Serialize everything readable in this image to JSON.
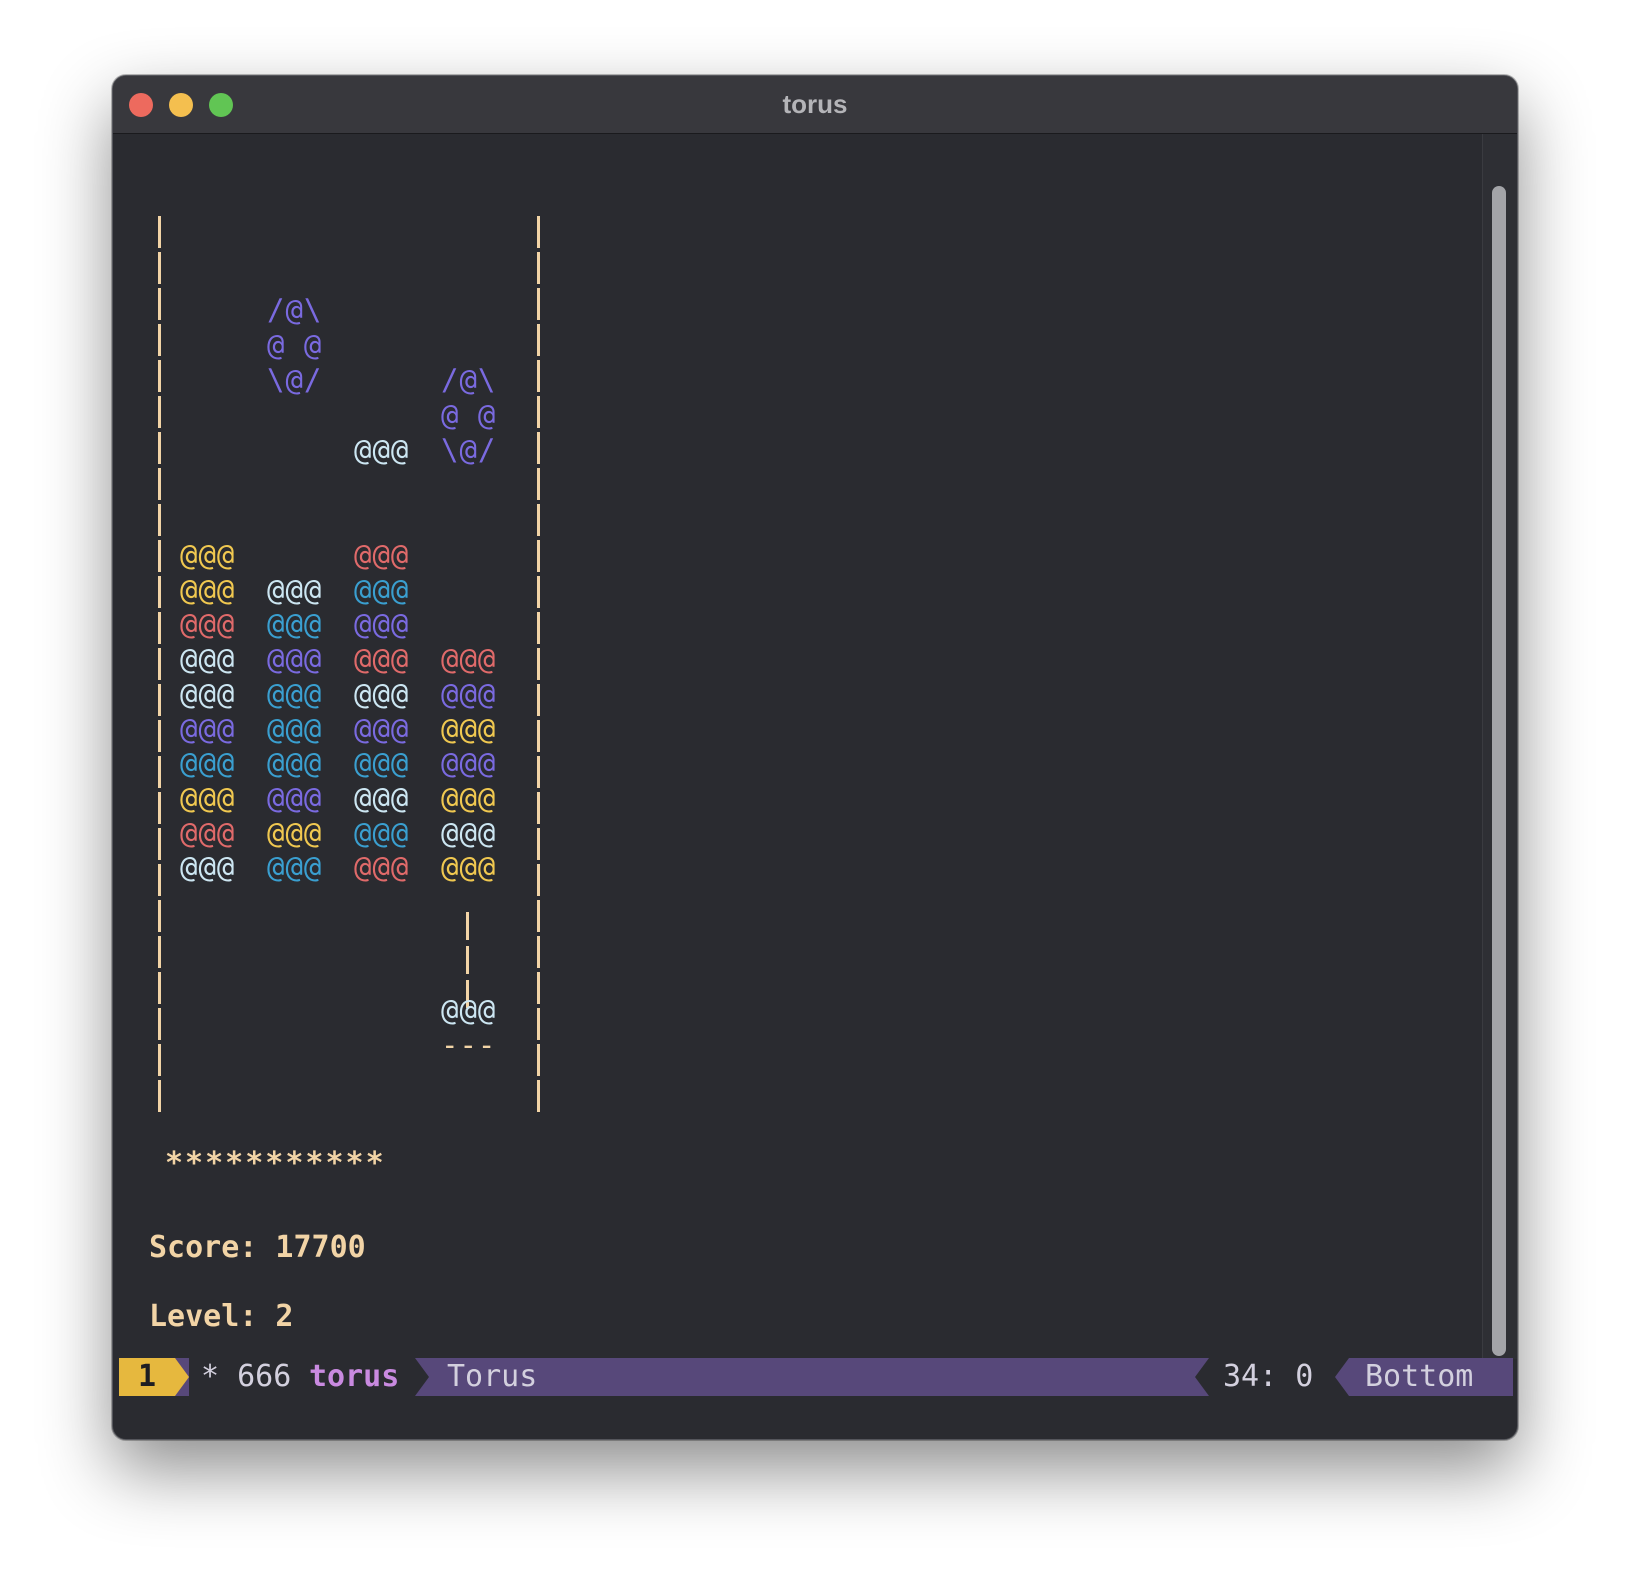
{
  "window": {
    "title": "torus"
  },
  "colors": {
    "yellow": "#f0c850",
    "white": "#cce6f2",
    "red": "#e06a6a",
    "blue": "#3a9fd0",
    "purple": "#7a6ae0",
    "border": "#f2d4a6"
  },
  "game": {
    "columns": 4,
    "stack_rows": [
      [
        "yellow",
        null,
        "red",
        null
      ],
      [
        "yellow",
        "white",
        "blue",
        null
      ],
      [
        "red",
        "blue",
        "purple",
        null
      ],
      [
        "white",
        "purple",
        "red",
        "red"
      ],
      [
        "white",
        "blue",
        "white",
        "purple"
      ],
      [
        "purple",
        "blue",
        "purple",
        "yellow"
      ],
      [
        "blue",
        "blue",
        "blue",
        "purple"
      ],
      [
        "yellow",
        "purple",
        "white",
        "yellow"
      ],
      [
        "red",
        "yellow",
        "blue",
        "white"
      ],
      [
        "white",
        "blue",
        "red",
        "yellow"
      ]
    ],
    "falling_piece": "@@@",
    "spinner_top": "/@\\",
    "spinner_mid": "@ @",
    "spinner_bottom": "\\@/",
    "base_piece": "@@@",
    "base_line": "---",
    "stars": "***********",
    "score_label": "Score: 17700",
    "level_label": "Level: 2"
  },
  "modeline": {
    "window_number": "1",
    "status": "* 666",
    "buffer_name": "torus",
    "mode": "Torus",
    "position": "34: 0",
    "scroll": "Bottom"
  }
}
